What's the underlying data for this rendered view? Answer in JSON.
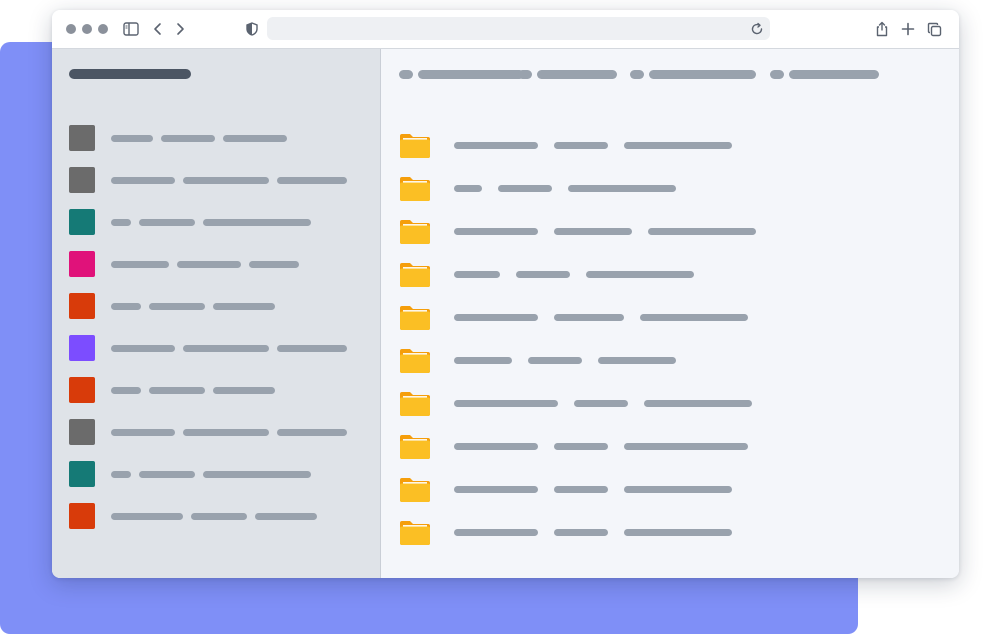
{
  "colors": {
    "backdrop": "#7f8ff7",
    "window_bg": "#f4f6fa",
    "sidebar_bg": "#dfe3e8",
    "titlebar_bg": "#ffffff",
    "dot_gray": "#8b919b",
    "placeholder_bar": "#99a2ad",
    "sidebar_title_bar": "#4b5563",
    "folder_back": "#f59e0b",
    "folder_front": "#fbbf24",
    "icon_stroke": "#5b6370"
  },
  "titlebar": {
    "traffic_lights": [
      "dot-1",
      "dot-2",
      "dot-3"
    ],
    "icons": [
      "sidebar-toggle-icon",
      "chevron-left-icon",
      "chevron-right-icon",
      "shield-icon",
      "reload-icon",
      "share-icon",
      "plus-icon",
      "tabs-overview-icon"
    ]
  },
  "sidebar": {
    "items": [
      {
        "color": "#6b6b6b"
      },
      {
        "color": "#6b6b6b"
      },
      {
        "color": "#157a76"
      },
      {
        "color": "#e0127a"
      },
      {
        "color": "#d83b0a"
      },
      {
        "color": "#7c4dff"
      },
      {
        "color": "#d83b0a"
      },
      {
        "color": "#6b6b6b"
      },
      {
        "color": "#157a76"
      },
      {
        "color": "#d83b0a"
      }
    ]
  },
  "main": {
    "breadcrumb_count": 4,
    "folder_count": 10
  }
}
